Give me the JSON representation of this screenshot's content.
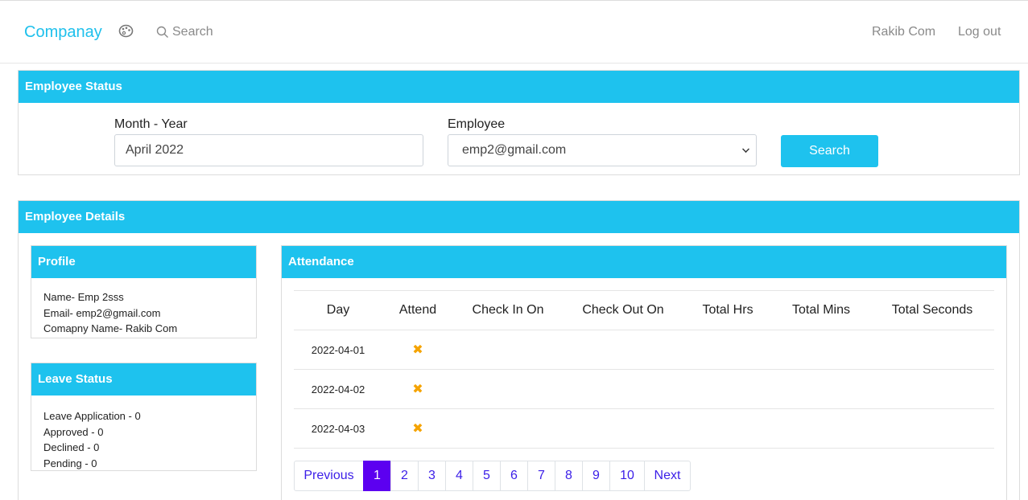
{
  "nav": {
    "brand": "Companay",
    "search_label": "Search",
    "user": "Rakib Com",
    "logout": "Log out"
  },
  "status_card": {
    "title": "Employee Status",
    "month_label": "Month - Year",
    "month_value": "April 2022",
    "employee_label": "Employee",
    "employee_value": "emp2@gmail.com",
    "search_button": "Search"
  },
  "details_card": {
    "title": "Employee Details",
    "profile": {
      "title": "Profile",
      "lines": [
        "Name- Emp 2sss",
        "Email- emp2@gmail.com",
        "Comapny Name- Rakib Com"
      ]
    },
    "leave": {
      "title": "Leave Status",
      "lines": [
        "Leave Application - 0",
        "Approved - 0",
        "Declined - 0",
        "Pending - 0"
      ]
    },
    "attendance": {
      "title": "Attendance",
      "columns": [
        "Day",
        "Attend",
        "Check In On",
        "Check Out On",
        "Total Hrs",
        "Total Mins",
        "Total Seconds"
      ],
      "rows": [
        {
          "day": "2022-04-01",
          "attend": "✖",
          "check_in": "",
          "check_out": "",
          "hrs": "",
          "mins": "",
          "secs": ""
        },
        {
          "day": "2022-04-02",
          "attend": "✖",
          "check_in": "",
          "check_out": "",
          "hrs": "",
          "mins": "",
          "secs": ""
        },
        {
          "day": "2022-04-03",
          "attend": "✖",
          "check_in": "",
          "check_out": "",
          "hrs": "",
          "mins": "",
          "secs": ""
        }
      ]
    },
    "pagination": {
      "previous": "Previous",
      "pages": [
        "1",
        "2",
        "3",
        "4",
        "5",
        "6",
        "7",
        "8",
        "9",
        "10"
      ],
      "active": "1",
      "next": "Next"
    }
  },
  "colors": {
    "accent": "#1ec2ee",
    "brand": "#1ec0ec",
    "pager_active": "#5c00f0",
    "absent_mark": "#f5a300"
  },
  "icons": {
    "palette": "palette-icon",
    "search": "search-icon",
    "absent": "x-mark-icon",
    "select": "chevron-down-icon"
  }
}
